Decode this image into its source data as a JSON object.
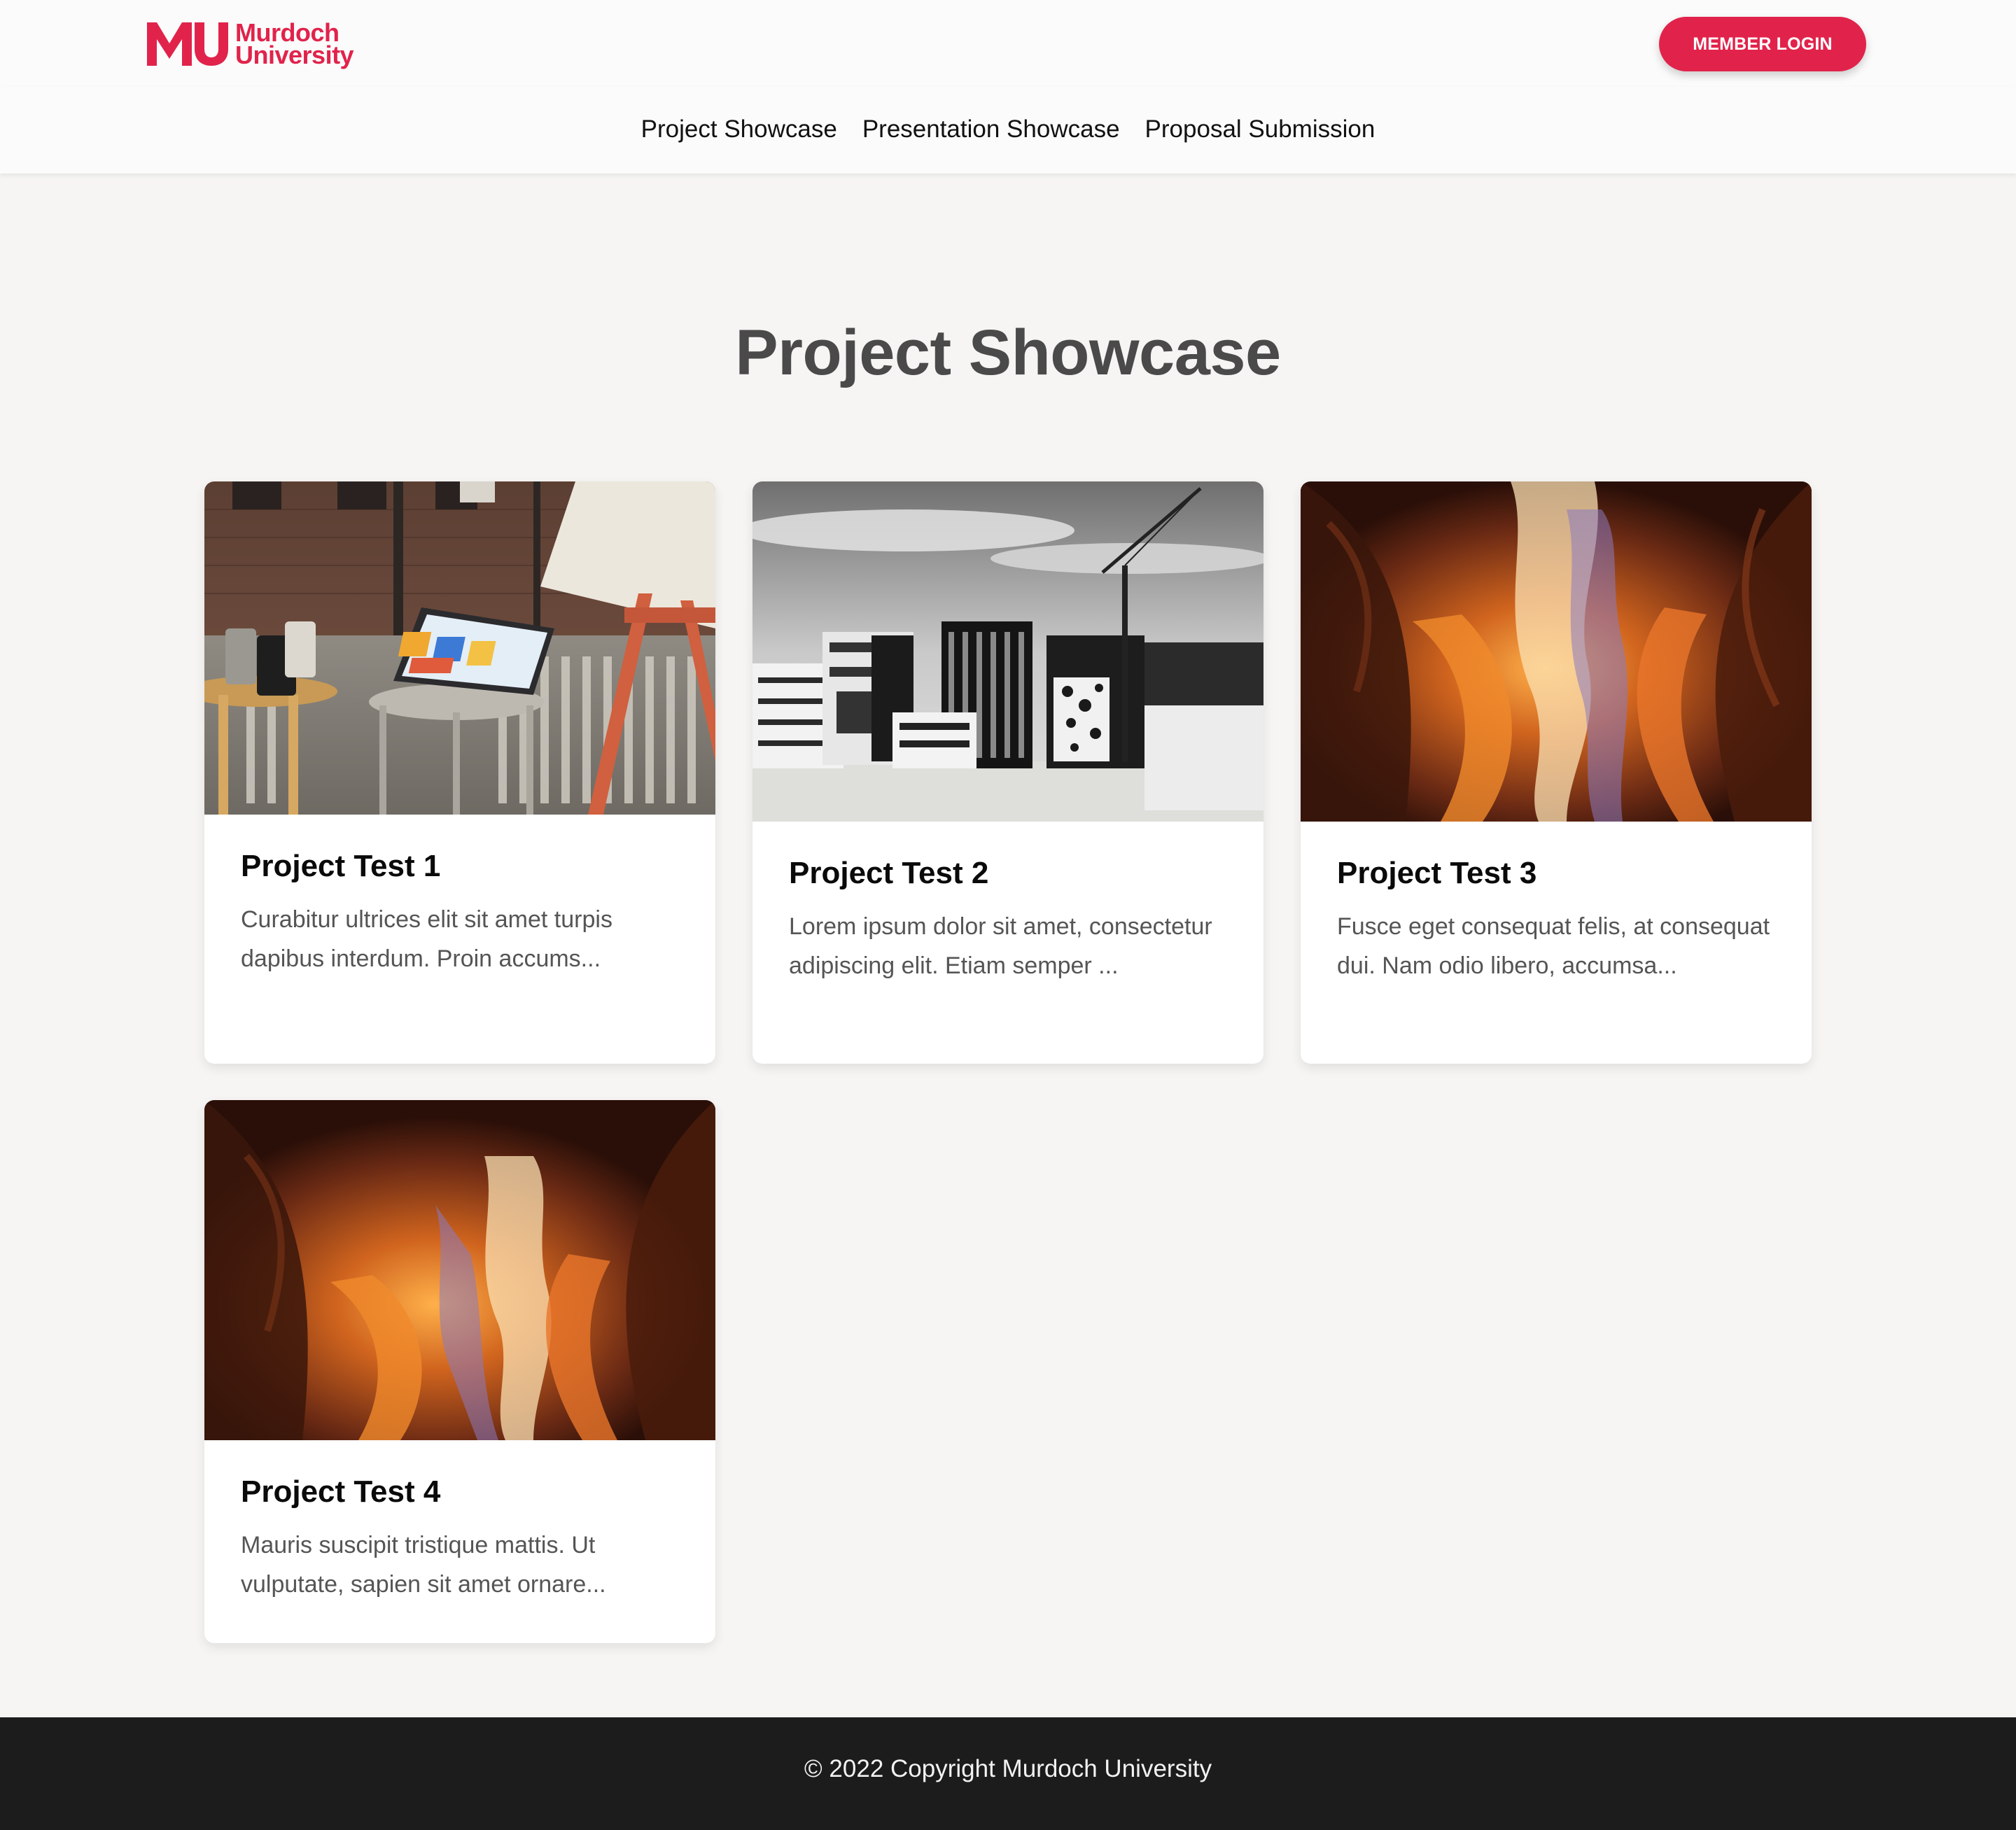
{
  "brand": {
    "line1": "Murdoch",
    "line2": "University",
    "color": "#e1234b"
  },
  "header": {
    "login_label": "MEMBER LOGIN"
  },
  "nav": {
    "items": [
      "Project Showcase",
      "Presentation Showcase",
      "Proposal Submission"
    ]
  },
  "page": {
    "title": "Project Showcase"
  },
  "projects": [
    {
      "title": "Project Test 1",
      "excerpt": "Curabitur ultrices elit sit amet turpis dapibus interdum. Proin accums...",
      "image": "photo-laptop-on-stool"
    },
    {
      "title": "Project Test 2",
      "excerpt": "Lorem ipsum dolor sit amet, consectetur adipiscing elit. Etiam semper ...",
      "image": "photo-city-buildings-crane"
    },
    {
      "title": "Project Test 3",
      "excerpt": "Fusce eget consequat felis, at consequat dui. Nam odio libero, accumsa...",
      "image": "photo-canyon"
    },
    {
      "title": "Project Test 4",
      "excerpt": "Mauris suscipit tristique mattis. Ut vulputate, sapien sit amet ornare...",
      "image": "photo-canyon"
    }
  ],
  "footer": {
    "copyright": "© 2022 Copyright Murdoch University"
  }
}
